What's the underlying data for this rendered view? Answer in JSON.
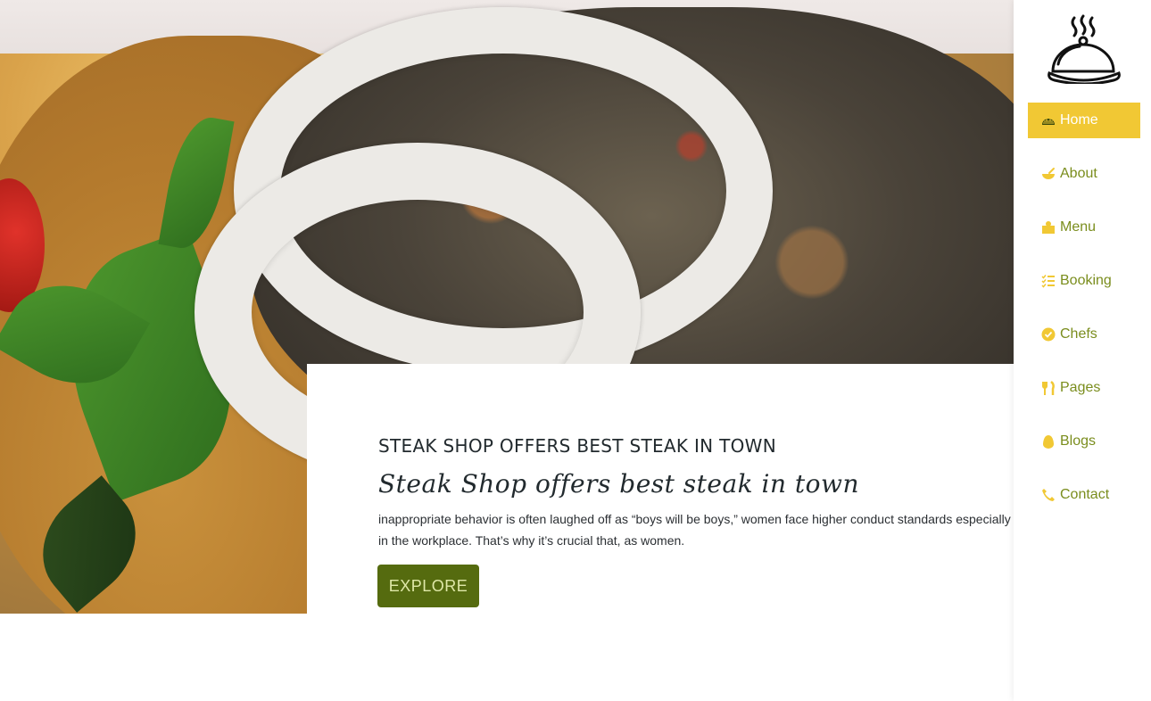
{
  "hero": {
    "kicker": "STEAK SHOP OFFERS BEST STEAK IN TOWN",
    "script_title": "Steak Shop offers best steak in town",
    "description": "inappropriate behavior is often laughed off as “boys will be boys,” women face higher conduct standards especially in the workplace. That’s why it’s crucial that, as women.",
    "cta_label": "EXPLORE"
  },
  "nav": {
    "items": [
      {
        "label": "Home",
        "icon": "igloo-icon",
        "active": true
      },
      {
        "label": "About",
        "icon": "bowl-icon",
        "active": false
      },
      {
        "label": "Menu",
        "icon": "chef-icon",
        "active": false
      },
      {
        "label": "Booking",
        "icon": "list-check-icon",
        "active": false
      },
      {
        "label": "Chefs",
        "icon": "check-circle-icon",
        "active": false
      },
      {
        "label": "Pages",
        "icon": "utensils-icon",
        "active": false
      },
      {
        "label": "Blogs",
        "icon": "egg-icon",
        "active": false
      },
      {
        "label": "Contact",
        "icon": "phone-icon",
        "active": false
      }
    ]
  },
  "colors": {
    "accent": "#f1c834",
    "nav_text": "#7a8d1d",
    "cta_bg": "#556b0f"
  }
}
